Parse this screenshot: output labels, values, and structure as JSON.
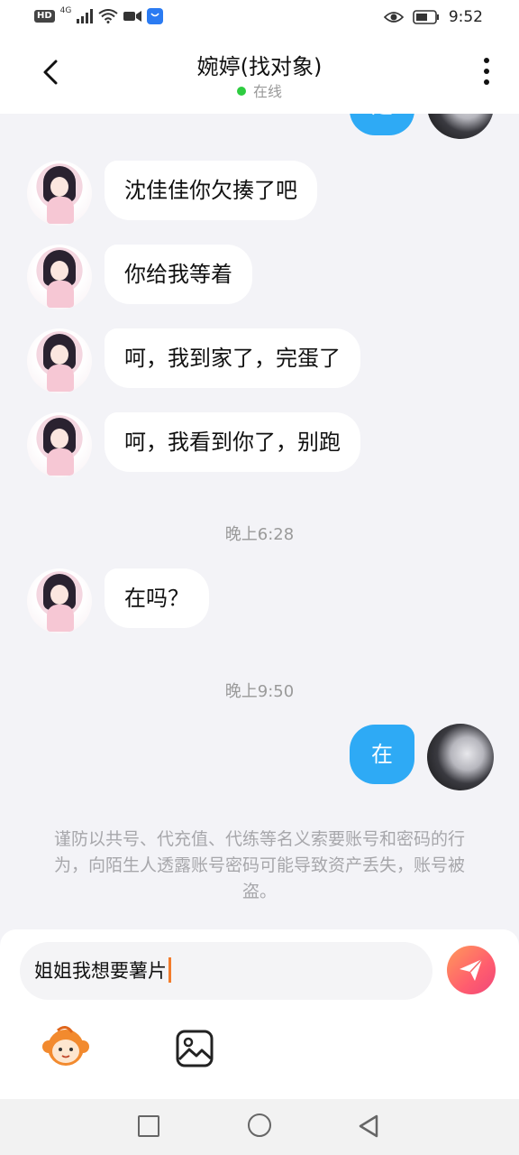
{
  "status_bar": {
    "hd_label": "HD",
    "network_label": "4G",
    "time": "9:52"
  },
  "header": {
    "title": "婉婷(找对象)",
    "online_status": "在线"
  },
  "messages": [
    {
      "side": "left",
      "text": "沈佳佳你欠揍了吧"
    },
    {
      "side": "left",
      "text": "你给我等着"
    },
    {
      "side": "left",
      "text": "呵，我到家了，完蛋了"
    },
    {
      "side": "left",
      "text": "呵，我看到你了，别跑"
    },
    {
      "type": "time",
      "text": "晚上6:28"
    },
    {
      "side": "left",
      "text": "在吗？"
    },
    {
      "type": "time",
      "text": "晚上9:50"
    },
    {
      "side": "right",
      "text": "在"
    }
  ],
  "top_partial_bubble": "是",
  "notice": "谨防以共号、代充值、代练等名义索要账号和密码的行为，向陌生人透露账号密码可能导致资产丢失，账号被盗。",
  "input": {
    "value": "姐姐我想要薯片"
  },
  "colors": {
    "accent_blue": "#2eaaf5",
    "send_gradient_start": "#ff9a5a",
    "send_gradient_end": "#f0467a",
    "online_green": "#2ecc40"
  }
}
